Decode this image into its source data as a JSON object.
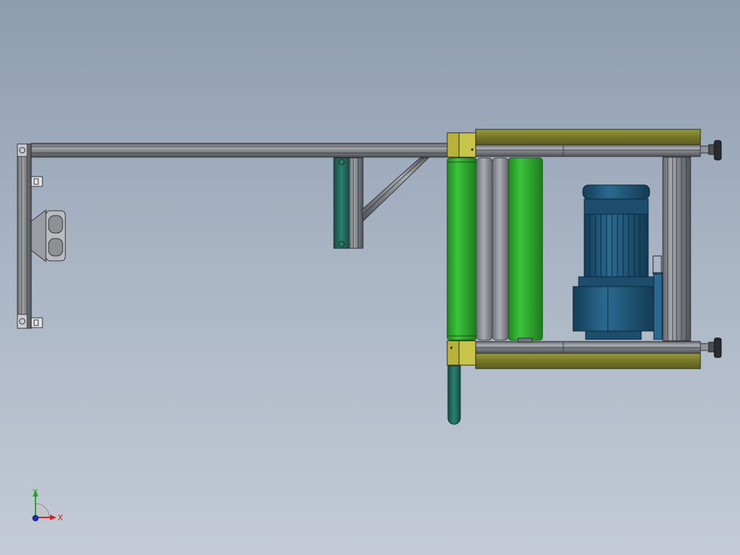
{
  "triad": {
    "x_label": "X",
    "y_label": "Y",
    "x_color": "#d42020",
    "y_color": "#1ea81e",
    "z_color": "#1a2cc8"
  },
  "colors": {
    "background_top": "#8e9cb0",
    "background_bottom": "#c4cbd6",
    "aluminum_profile": "#8a8d92",
    "roller_green": "#2fb52f",
    "roller_grey": "#8c8f96",
    "motor_blue": "#1f5576",
    "side_plate_olive": "#8a8a30",
    "bearing_yellow": "#b5b03a",
    "handle_teal": "#1f6b5e"
  }
}
